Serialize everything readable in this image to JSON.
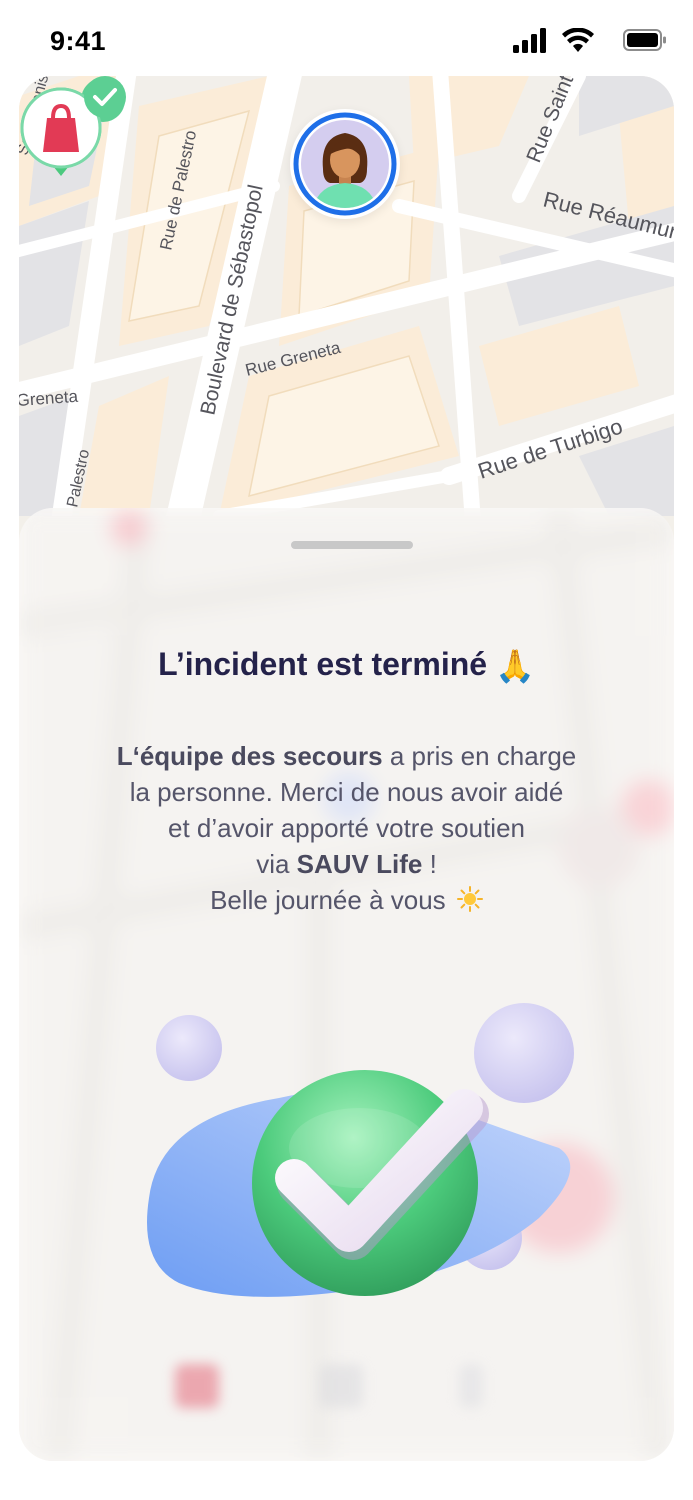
{
  "status_bar": {
    "time": "9:41"
  },
  "map": {
    "street_labels": [
      "Saint-Denis",
      "Rue de Palestro",
      "Boulevard de Sébastopol",
      "Rue Greneta",
      "Greneta",
      "Rue Saint",
      "Rue Réaumur",
      "Rue de Turbigo",
      "Palestro"
    ]
  },
  "sheet": {
    "title": "L’incident est terminé",
    "title_emoji": "🙏",
    "body": {
      "part1_bold": "L‘équipe des secours",
      "part1": " a pris en charge",
      "line2": "la personne. Merci de nous avoir aidé",
      "line3": "et d’avoir apporté votre soutien",
      "line4_prefix": "via ",
      "line4_bold": "SAUV Life",
      "line4_suffix": " !",
      "line5": "Belle journée à vous"
    }
  },
  "colors": {
    "title": "#24224a",
    "body_text": "#55556a",
    "check_green": "#4cc97f",
    "avatar_ring": "#1f6fe8",
    "aed_red": "#e23a55",
    "blob_blue": "#7ba7f5"
  },
  "icons": {
    "avatar": "person-avatar-icon",
    "aed": "defibrillator-bag-icon",
    "success": "check-circle-icon",
    "sun": "sun-icon",
    "pray": "praying-hands-emoji"
  }
}
